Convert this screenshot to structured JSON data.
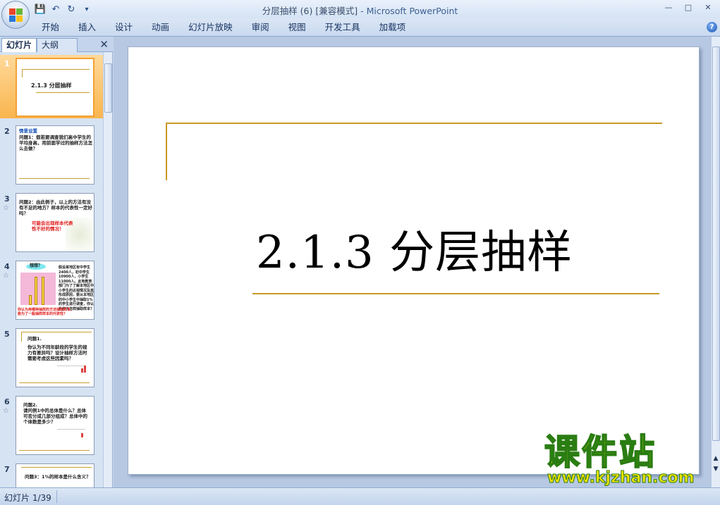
{
  "window": {
    "title": "分层抽样 (6) [兼容模式]",
    "app_name": " - Microsoft PowerPoint",
    "controls": [
      "—",
      "□",
      "✕"
    ]
  },
  "qat": {
    "save_icon": "💾",
    "undo_icon": "↶",
    "redo_icon": "↻",
    "customize_icon": "▾"
  },
  "ribbon": {
    "tabs": [
      "开始",
      "插入",
      "设计",
      "动画",
      "幻灯片放映",
      "审阅",
      "视图",
      "开发工具",
      "加载项"
    ],
    "help": "?"
  },
  "left_pane": {
    "tab_slides": "幻灯片",
    "tab_outline": "大纲",
    "close": "✕",
    "thumbnails": [
      {
        "num": "1",
        "title": "2.1.3   分层抽样"
      },
      {
        "num": "2",
        "heading": "情景设置",
        "body": "问题1：假若要调查我们高中学生的平均身高，用前面学过的抽样方法怎么去做？"
      },
      {
        "num": "3",
        "anim": "☆",
        "body": "问题2：由此例子，以上的方法有没有不足的地方？样本的代表性一定好吗？",
        "red": "可能会出现样本代表性不好的情况！"
      },
      {
        "num": "4",
        "anim": "☆",
        "bubble": "想想？",
        "side": "假设某地区有中学生2400人，初中学生10900人，小学生11000人。此地教育部门为了了解本地区中小学生的近视情况及其形成原因，要从本地区的中小学生中抽取1%的学生进行调查，你认为应当怎样抽取样本？",
        "red": "你认为用哪种抽样的方法抽取样本，能为了一般抽样样本的代表性？"
      },
      {
        "num": "5",
        "heading": "问题1.",
        "body": "你认为不同年龄段的学生的视力有差异吗？设计抽样方法时需要考虑这些因素吗？"
      },
      {
        "num": "6",
        "anim": "☆",
        "heading": "问题2.",
        "body": "请问例1中的总体是什么？总体可否分成几部分组成？总体中的个体数是多少？"
      },
      {
        "num": "7",
        "body": "问题3：1%的样本是什么含义？"
      }
    ]
  },
  "slide": {
    "title": "2.1.3   分层抽样"
  },
  "status": {
    "slide_indicator": "幻灯片 1/39"
  },
  "watermark": {
    "cn": "课件站",
    "url": "www.kjzhan.com"
  },
  "colors": {
    "accent_gold": "#c89a24",
    "selected_thumb": "#f9b54e",
    "ribbon_bg": "#c9d9ef"
  }
}
